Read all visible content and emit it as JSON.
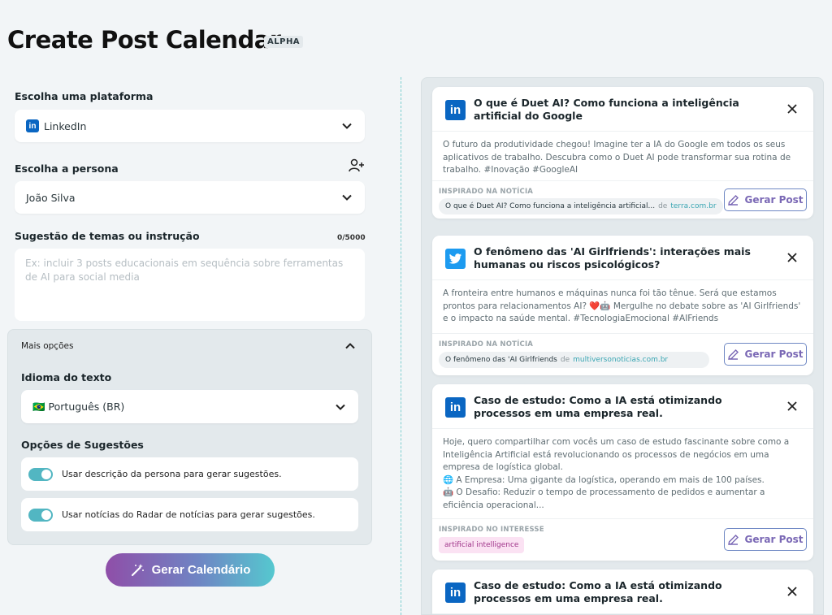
{
  "page": {
    "title": "Create Post Calendar",
    "badge": "ALPHA"
  },
  "form": {
    "platform_label": "Escolha uma plataforma",
    "platform_value": "LinkedIn",
    "persona_label": "Escolha a persona",
    "persona_value": "João Silva",
    "themes_label": "Sugestão de temas ou instrução",
    "themes_counter": "0/5000",
    "themes_placeholder": "Ex: incluir 3 posts educacionais em sequência sobre ferramentas de AI para social media"
  },
  "more_options": {
    "title": "Mais opções",
    "language_label": "Idioma do texto",
    "language_value": "🇧🇷 Português (BR)",
    "suggestions_label": "Opções de Sugestões",
    "toggle1": "Usar descrição da persona para gerar sugestões.",
    "toggle2": "Usar notícias do Radar de notícias para gerar sugestões."
  },
  "generate_button": "Gerar Calendário",
  "cards": [
    {
      "platform": "LinkedIn",
      "title": "O que é Duet AI? Como funciona a inteligência artificial do Google",
      "body": "O futuro da produtividade chegou! Imagine ter a IA do Google em todos os seus aplicativos de trabalho. Descubra como o Duet AI pode transformar sua rotina de trabalho. #Inovação #GoogleAI",
      "inspired_label": "INSPIRADO NA NOTÍCIA",
      "news_title": "O que é Duet AI? Como funciona a inteligência artificial...",
      "news_de": "de",
      "news_source": "terra.com.br",
      "button": "Gerar Post"
    },
    {
      "platform": "Twitter",
      "title": "O fenômeno das 'AI Girlfriends': interações mais humanas ou riscos psicológicos?",
      "body": "A fronteira entre humanos e máquinas nunca foi tão tênue. Será que estamos prontos para relacionamentos AI? ❤️🤖 Mergulhe no debate sobre as 'AI Girlfriends' e o impacto na saúde mental. #TecnologiaEmocional #AIFriends",
      "inspired_label": "INSPIRADO NA NOTÍCIA",
      "news_title": "O fenômeno das 'AI Girlfriends",
      "news_de": "de",
      "news_source": "multiversonoticias.com.br",
      "button": "Gerar Post"
    },
    {
      "platform": "LinkedIn",
      "title": "Caso de estudo: Como a IA está otimizando processos em uma empresa real.",
      "body_lines": [
        "Hoje, quero compartilhar com vocês um caso de estudo fascinante sobre como a Inteligência Artificial está revolucionando os processos de negócios em uma empresa de logística global.",
        "🌐 A Empresa: Uma gigante da logística, operando em mais de 100 países.",
        "🤖 O Desafio: Reduzir o tempo de processamento de pedidos e aumentar a eficiência operacional..."
      ],
      "inspired_label": "INSPIRADO NO INTERESSE",
      "interest_tag": "artificial intelligence",
      "button": "Gerar Post"
    },
    {
      "platform": "LinkedIn",
      "title": "Caso de estudo: Como a IA está otimizando processos em uma empresa real."
    }
  ],
  "colors": {
    "accent": "#52b6c2",
    "linkedin": "#0a66c2",
    "twitter": "#1d9bf0"
  }
}
